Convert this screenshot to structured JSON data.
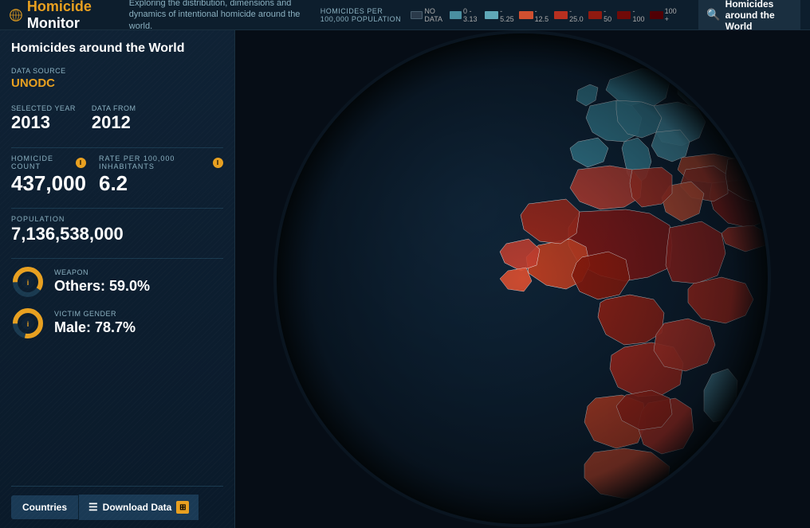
{
  "header": {
    "logo_homicide": "Homicide",
    "logo_monitor": " Monitor",
    "tagline": "Exploring the distribution, dimensions and dynamics of intentional homicide around the world.",
    "legend_label": "HOMICIDES PER 100,000 POPULATION",
    "legend_items": [
      {
        "label": "NO DATA",
        "swatch": "nodata"
      },
      {
        "label": "0 - 3.13",
        "swatch": "0"
      },
      {
        "label": "- 5.25",
        "swatch": "1"
      },
      {
        "label": "- 12.5",
        "swatch": "2"
      },
      {
        "label": "- 25.0",
        "swatch": "3"
      },
      {
        "label": "- 50",
        "swatch": "4"
      },
      {
        "label": "- 100",
        "swatch": "5"
      },
      {
        "label": "100 +",
        "swatch": "6"
      }
    ],
    "search_title": "Homicides around the World"
  },
  "sidebar": {
    "title": "Homicides around the World",
    "source_label": "DATA SOURCE",
    "source_value": "UNODC",
    "selected_year_label": "SELECTED YEAR",
    "selected_year": "2013",
    "data_from_label": "DATA FROM",
    "data_from": "2012",
    "homicide_count_label": "HOMICIDE COUNT",
    "homicide_count": "437,000",
    "rate_label": "RATE PER 100,000 INHABITANTS",
    "rate_value": "6.2",
    "population_label": "POPULATION",
    "population_value": "7,136,538,000",
    "weapon_label": "WEAPON",
    "weapon_value": "Others: 59.0%",
    "victim_gender_label": "VICTIM GENDER",
    "victim_gender_value": "Male: 78.7%",
    "btn_countries": "Countries",
    "btn_download": "Download Data"
  }
}
